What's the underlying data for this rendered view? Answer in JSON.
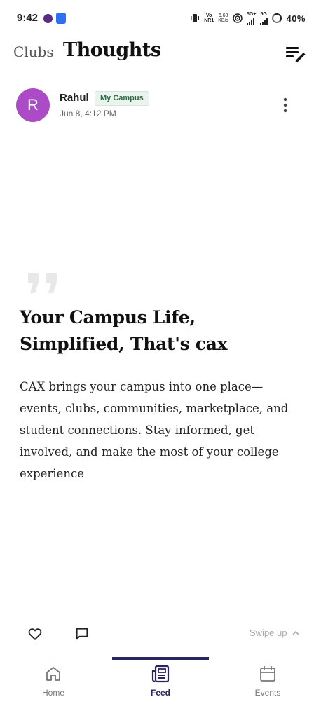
{
  "status_bar": {
    "time": "9:42",
    "volte": "Vo",
    "volte_sub": "NR1",
    "speed": "6.60",
    "speed_unit": "KB/s",
    "net1": "5G+",
    "net2": "5G",
    "battery": "40%"
  },
  "header": {
    "tab_clubs": "Clubs",
    "tab_thoughts": "Thoughts"
  },
  "post": {
    "avatar_letter": "R",
    "author": "Rahul",
    "badge": "My Campus",
    "timestamp": "Jun 8, 4:12 PM",
    "title": "Your Campus Life, Simplified, That's cax",
    "body": "CAX brings your campus into one place—events, clubs, communities, marketplace, and student connections. Stay informed, get involved, and make the most of your college experience"
  },
  "actions": {
    "swipe_hint": "Swipe up"
  },
  "nav": {
    "items": [
      {
        "label": "Home",
        "icon": "home-icon"
      },
      {
        "label": "Feed",
        "icon": "newspaper-icon",
        "active": true
      },
      {
        "label": "Events",
        "icon": "calendar-icon"
      }
    ]
  },
  "colors": {
    "accent": "#2a2560",
    "avatar": "#ac4bc6",
    "badge_text": "#2f6b46",
    "badge_bg": "#eaf3ee"
  }
}
